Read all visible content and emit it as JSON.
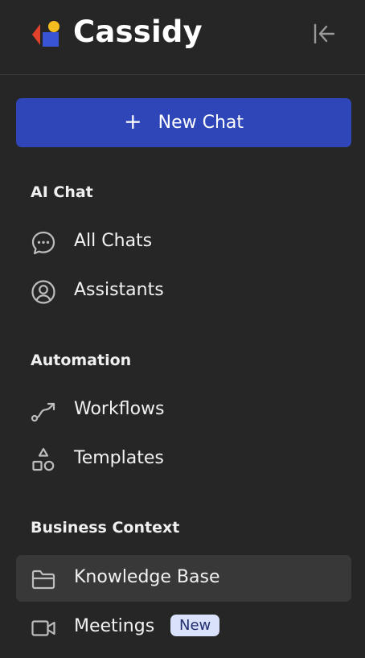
{
  "brand": {
    "name": "Cassidy",
    "colors": {
      "red": "#e2412c",
      "yellow": "#f4bd1f",
      "blue": "#3a54d6"
    }
  },
  "header": {
    "collapse_icon": "collapse-left-icon"
  },
  "new_chat": {
    "label": "New Chat",
    "icon": "plus-icon",
    "color": "#2e46b8"
  },
  "sections": {
    "ai_chat": {
      "title": "AI Chat",
      "items": [
        {
          "label": "All Chats",
          "icon": "chat-bubble-icon"
        },
        {
          "label": "Assistants",
          "icon": "user-circle-icon"
        }
      ]
    },
    "automation": {
      "title": "Automation",
      "items": [
        {
          "label": "Workflows",
          "icon": "workflow-icon"
        },
        {
          "label": "Templates",
          "icon": "shapes-icon"
        }
      ]
    },
    "business_context": {
      "title": "Business Context",
      "items": [
        {
          "label": "Knowledge Base",
          "icon": "folder-icon",
          "active": true
        },
        {
          "label": "Meetings",
          "icon": "video-camera-icon",
          "badge": "New"
        }
      ]
    }
  }
}
